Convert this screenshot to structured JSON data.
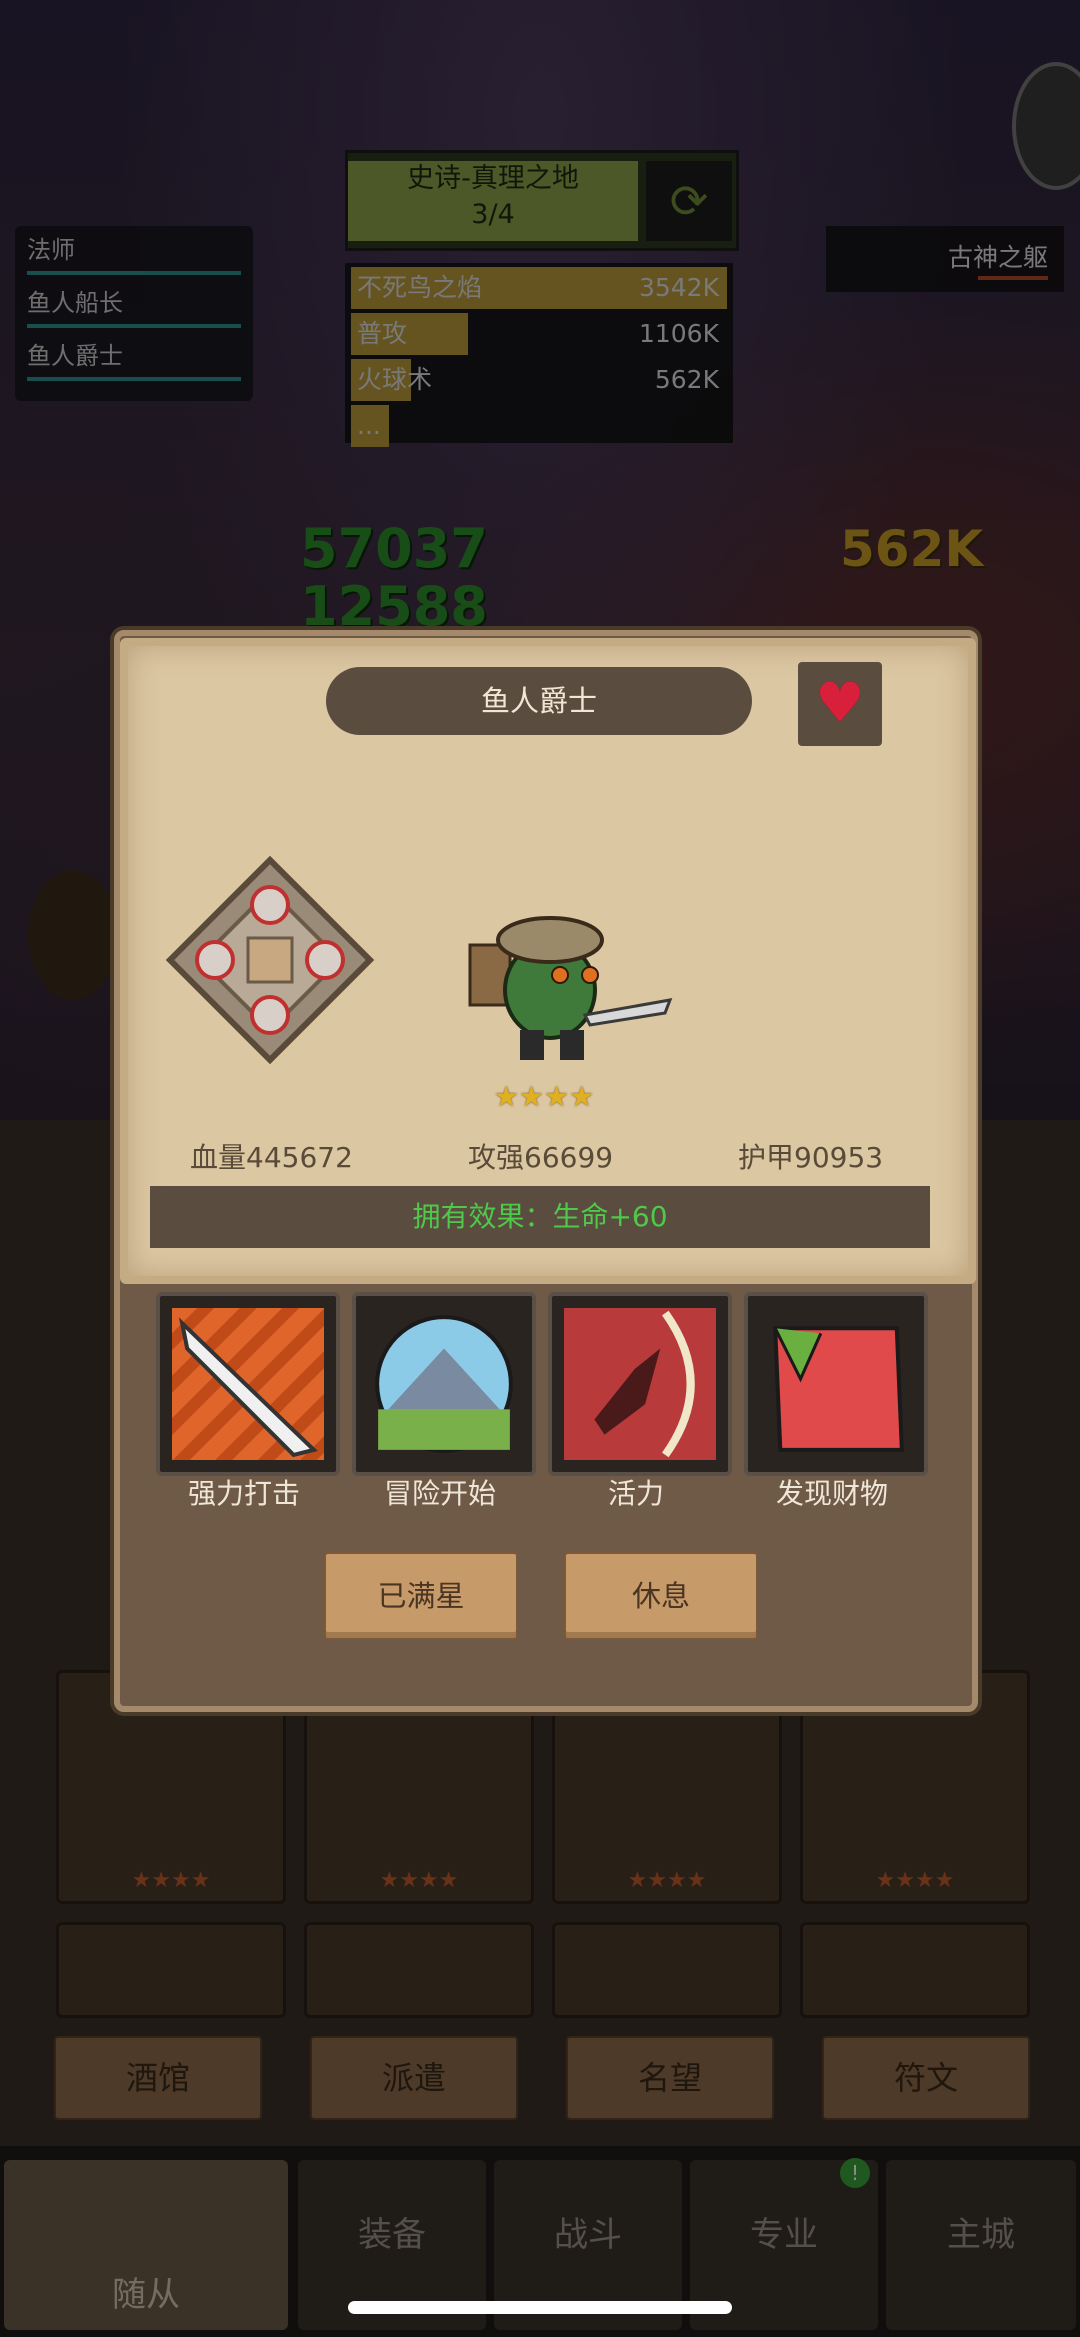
{
  "party": [
    "法师",
    "鱼人船长",
    "鱼人爵士"
  ],
  "quest": {
    "title": "史诗-真理之地",
    "progress": "3/4"
  },
  "damage": [
    {
      "name": "不死鸟之焰",
      "value": "3542K",
      "fill": 1.0
    },
    {
      "name": "普攻",
      "value": "1106K",
      "fill": 0.31
    },
    {
      "name": "火球术",
      "value": "562K",
      "fill": 0.16
    },
    {
      "name": "...",
      "value": "",
      "fill": 0.1
    }
  ],
  "boss_name": "古神之躯",
  "floating": {
    "green_top": "57037",
    "green_bottom": "12588",
    "yellow": "562K"
  },
  "hero": {
    "name": "鱼人爵士",
    "stars": "★★★★",
    "hp": "血量445672",
    "attack": "攻强66699",
    "armor": "护甲90953",
    "effect": "拥有效果：生命+60"
  },
  "skills": [
    "强力打击",
    "冒险开始",
    "活力",
    "发现财物"
  ],
  "buttons": {
    "max_star": "已满星",
    "rest": "休息"
  },
  "section_tabs": [
    "酒馆",
    "派遣",
    "名望",
    "符文"
  ],
  "nav": [
    "随从",
    "装备",
    "战斗",
    "专业",
    "主城"
  ],
  "nav_badge": "!",
  "grid_stars": "★★★★"
}
